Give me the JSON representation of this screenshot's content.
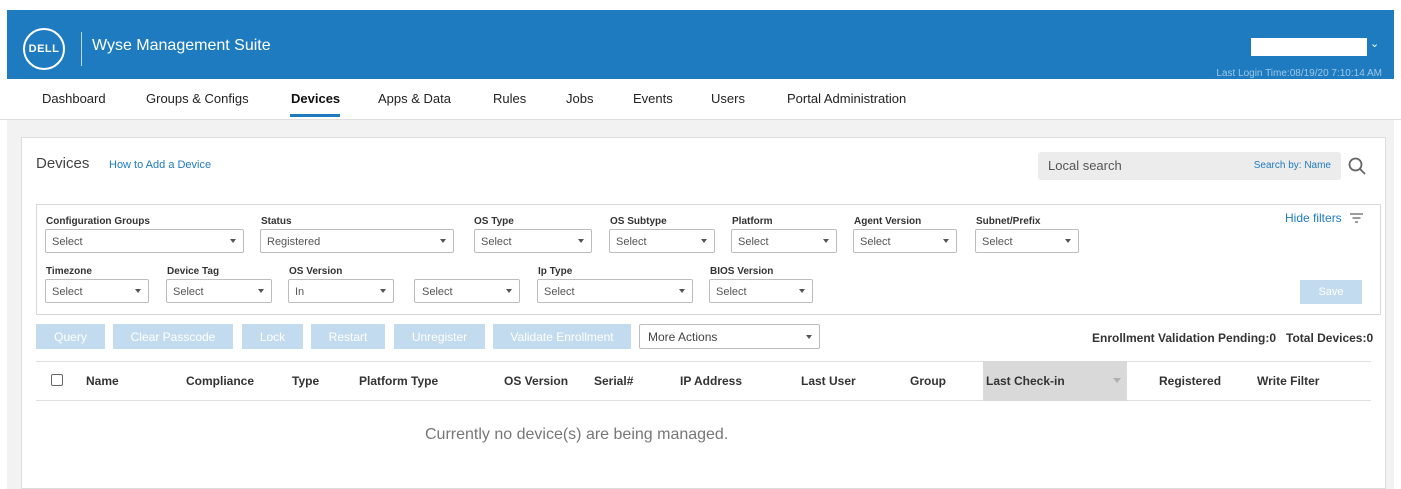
{
  "header": {
    "logo_text": "DELL",
    "app_title": "Wyse Management Suite",
    "last_login": "Last Login Time:08/19/20 7:10:14 AM",
    "brand_color": "#1e7bbf"
  },
  "nav": {
    "tabs": [
      {
        "label": "Dashboard"
      },
      {
        "label": "Groups & Configs"
      },
      {
        "label": "Devices"
      },
      {
        "label": "Apps & Data"
      },
      {
        "label": "Rules"
      },
      {
        "label": "Jobs"
      },
      {
        "label": "Events"
      },
      {
        "label": "Users"
      },
      {
        "label": "Portal Administration"
      }
    ],
    "active": "Devices"
  },
  "page": {
    "title": "Devices",
    "how_to_link": "How to Add a Device",
    "search_placeholder": "Local search",
    "search_by": "Search by: Name"
  },
  "filters": {
    "hide_filters": "Hide filters",
    "save_label": "Save",
    "row1": [
      {
        "label": "Configuration Groups",
        "value": "Select"
      },
      {
        "label": "Status",
        "value": "Registered"
      },
      {
        "label": "OS Type",
        "value": "Select"
      },
      {
        "label": "OS Subtype",
        "value": "Select"
      },
      {
        "label": "Platform",
        "value": "Select"
      },
      {
        "label": "Agent Version",
        "value": "Select"
      },
      {
        "label": "Subnet/Prefix",
        "value": "Select"
      }
    ],
    "row2": [
      {
        "label": "Timezone",
        "value": "Select"
      },
      {
        "label": "Device Tag",
        "value": "Select"
      },
      {
        "label": "OS Version",
        "value": "In"
      },
      {
        "label": "",
        "value": "Select"
      },
      {
        "label": "Ip Type",
        "value": "Select"
      },
      {
        "label": "BIOS Version",
        "value": "Select"
      }
    ]
  },
  "actions": {
    "buttons": [
      "Query",
      "Clear Passcode",
      "Lock",
      "Restart",
      "Unregister",
      "Validate Enrollment"
    ],
    "more_actions": "More Actions",
    "enrollment_pending": "Enrollment Validation Pending:0",
    "total_devices": "Total Devices:0"
  },
  "table": {
    "columns": [
      "Name",
      "Compliance",
      "Type",
      "Platform Type",
      "OS Version",
      "Serial#",
      "IP Address",
      "Last User",
      "Group",
      "Last Check-in",
      "Registered",
      "Write Filter"
    ],
    "sorted_column": "Last Check-in",
    "empty_message": "Currently no device(s) are being managed."
  }
}
